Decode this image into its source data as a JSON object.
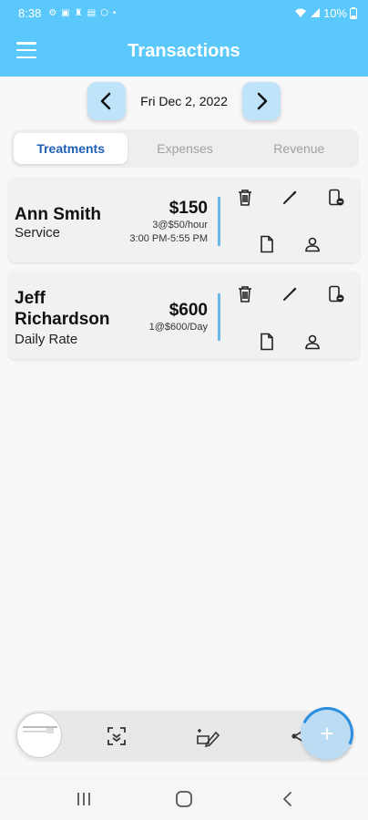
{
  "status": {
    "time": "8:38",
    "battery": "10%",
    "icons": [
      "settings-icon",
      "square-icon",
      "person-icon",
      "image-icon",
      "hexagon-icon",
      "dot-icon"
    ]
  },
  "header": {
    "title": "Transactions"
  },
  "date_nav": {
    "date": "Fri Dec 2, 2022"
  },
  "tabs": [
    {
      "label": "Treatments",
      "active": true
    },
    {
      "label": "Expenses",
      "active": false
    },
    {
      "label": "Revenue",
      "active": false
    }
  ],
  "transactions": [
    {
      "name": "Ann Smith",
      "type": "Service",
      "amount": "$150",
      "rate": "3@$50/hour",
      "time_range": "3:00 PM-5:55 PM"
    },
    {
      "name": "Jeff Richardson",
      "type": "Daily Rate",
      "amount": "$600",
      "rate": "1@$600/Day",
      "time_range": ""
    }
  ],
  "bottom_bar": {
    "icons": [
      "thumbnail-preview",
      "scan-icon",
      "edit-screenshot-icon",
      "share-icon"
    ],
    "fab": "+"
  },
  "colors": {
    "accent": "#5ac8fa",
    "tab_active": "#1e5fb8",
    "divider": "#6ab8e6"
  }
}
